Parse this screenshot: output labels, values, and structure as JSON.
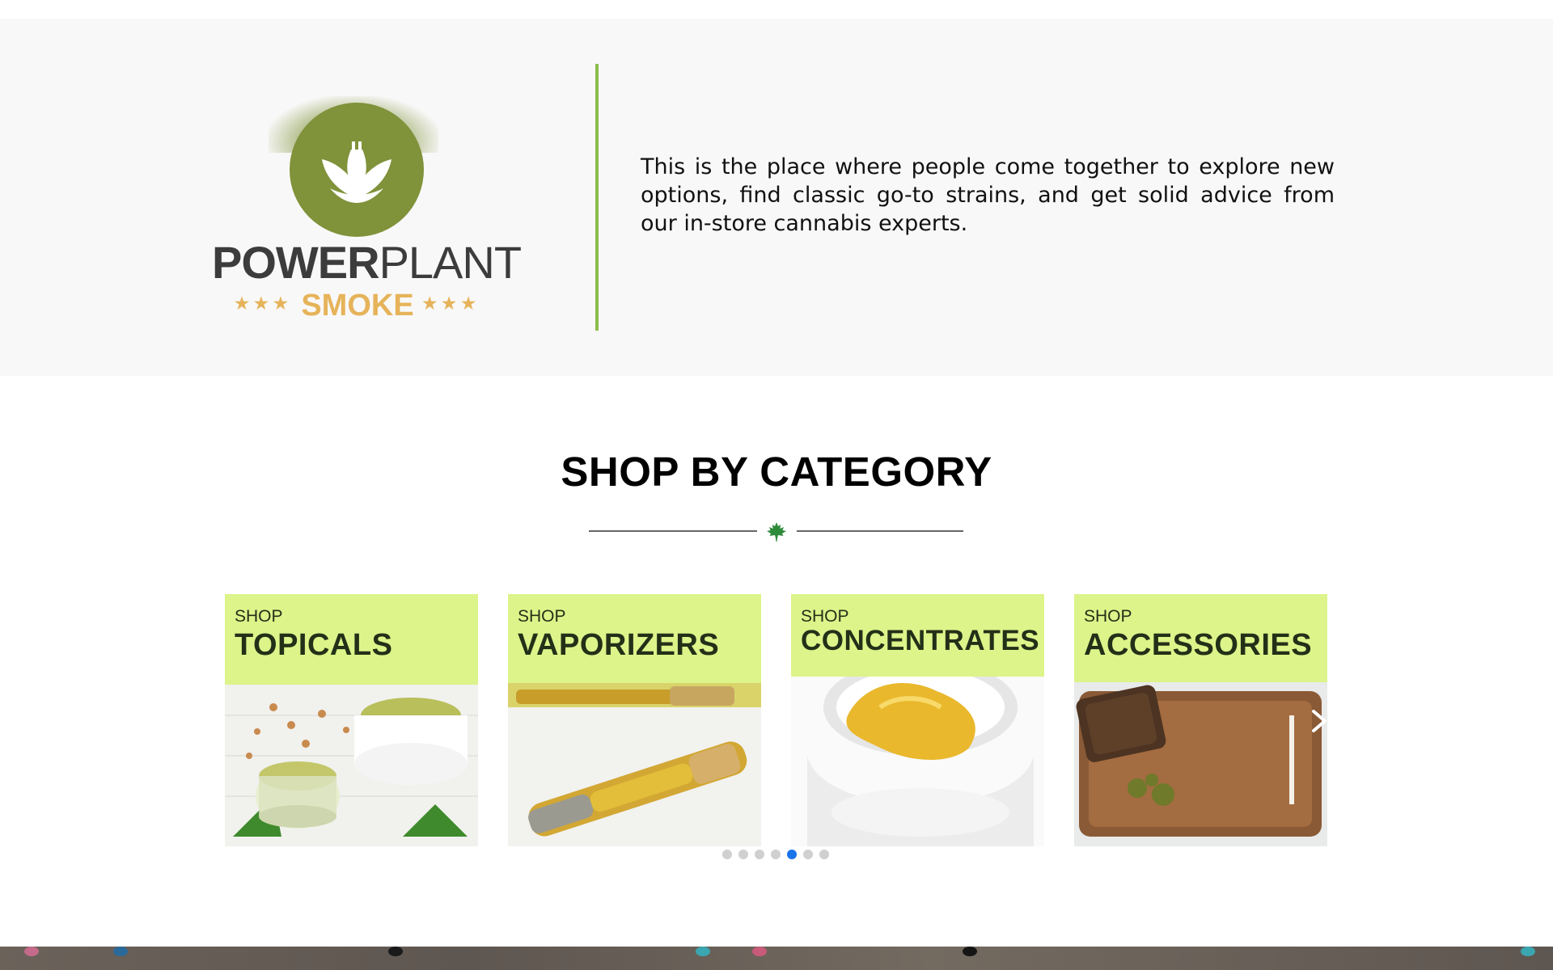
{
  "brand": {
    "word_bold": "POWER",
    "word_light": "PLANT",
    "sub": "SMOKE",
    "stars_left": "★★★",
    "stars_right": "★★★",
    "colors": {
      "circle": "#80923a",
      "sub": "#e6b35a",
      "accent_bar": "#8bbd4a"
    }
  },
  "hero": {
    "text": "This is the place where people come together to explore new options, find classic go-to strains, and get solid advice from our in-store cannabis experts."
  },
  "section": {
    "title": "SHOP BY CATEGORY",
    "divider_icon": "maple-leaf-icon"
  },
  "categories": [
    {
      "shop": "SHOP",
      "title": "TOPICALS"
    },
    {
      "shop": "SHOP",
      "title": "VAPORIZERS"
    },
    {
      "shop": "SHOP",
      "title": "CONCENTRATES"
    },
    {
      "shop": "SHOP",
      "title": "ACCESSORIES"
    }
  ],
  "carousel": {
    "next_icon": "chevron-right-icon",
    "dot_count": 7,
    "active_dot": 5,
    "active_color": "#1a73e8"
  }
}
